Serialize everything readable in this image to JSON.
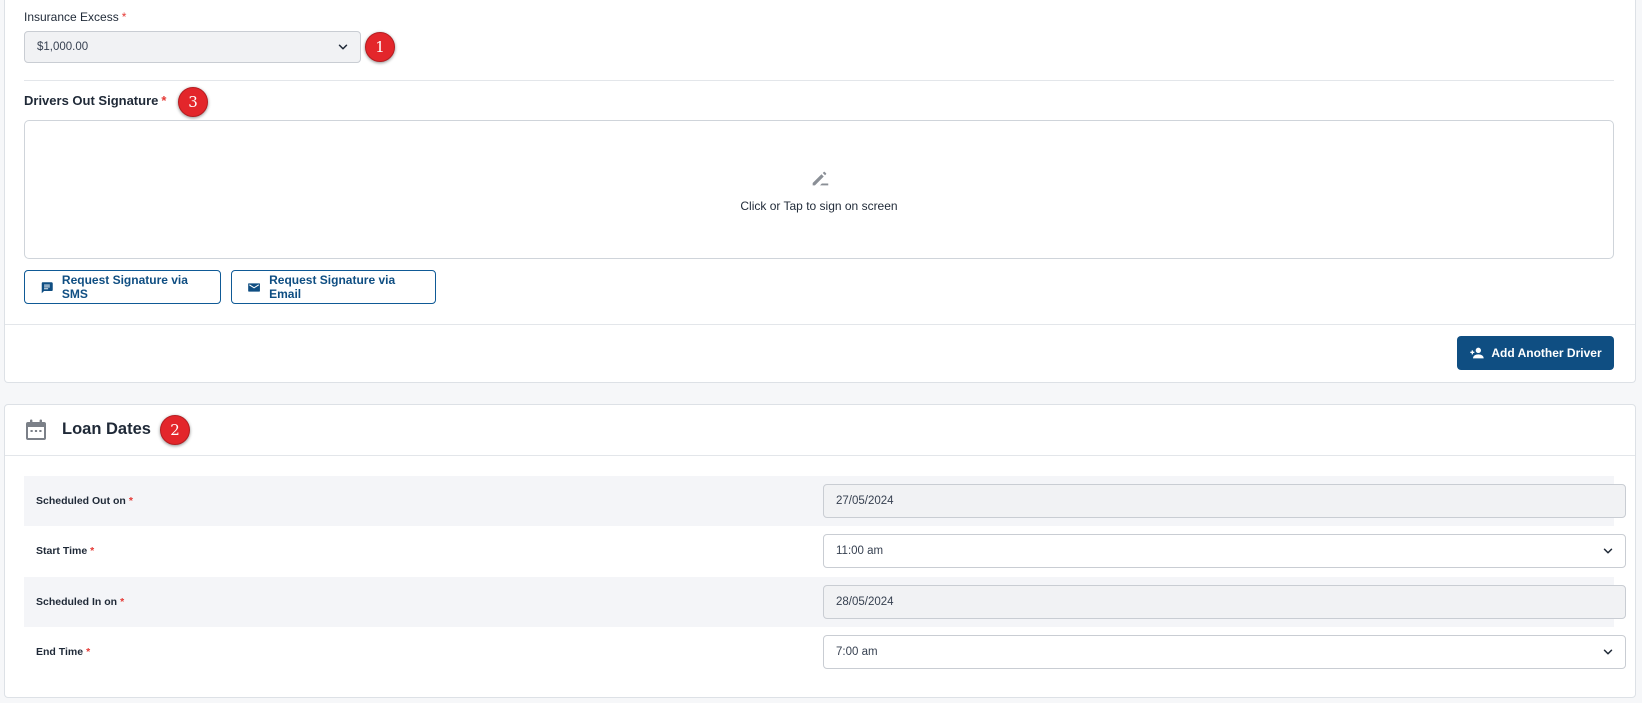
{
  "insurance": {
    "label": "Insurance Excess",
    "required": "*",
    "value": "$1,000.00",
    "badge": "1"
  },
  "signature": {
    "title": "Drivers Out Signature",
    "required": "*",
    "badge": "3",
    "hint": "Click or Tap to sign on screen",
    "icon": "pen-sign-icon",
    "sms_button": "Request Signature via SMS",
    "email_button": "Request Signature via Email"
  },
  "add_driver_button": "Add Another Driver",
  "loan_dates": {
    "title": "Loan Dates",
    "badge": "2",
    "rows": [
      {
        "label": "Scheduled Out on",
        "required": "*",
        "value": "27/05/2024"
      },
      {
        "label": "Start Time",
        "required": "*",
        "value": "11:00 am"
      },
      {
        "label": "Scheduled In on",
        "required": "*",
        "value": "28/05/2024"
      },
      {
        "label": "End Time",
        "required": "*",
        "value": "7:00 am"
      }
    ]
  },
  "colors": {
    "primary": "#0f4e82",
    "required": "#e53935",
    "badge": "#e3262b",
    "row_shade": "#f4f5f8"
  }
}
